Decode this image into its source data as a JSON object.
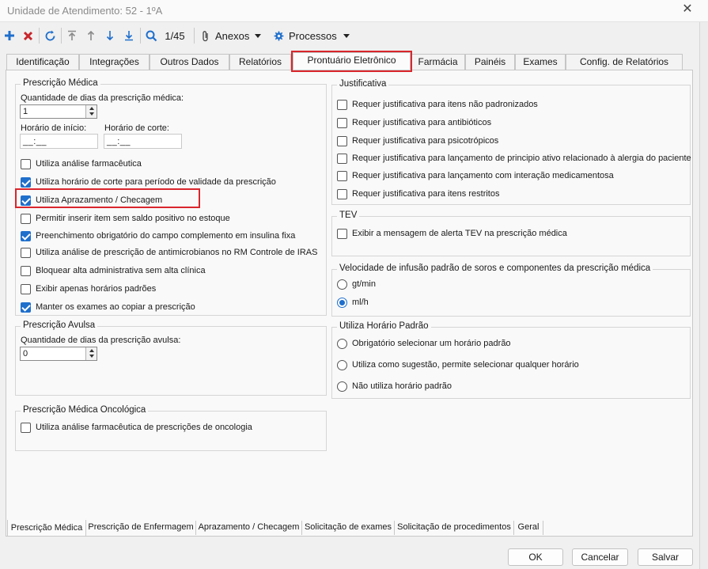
{
  "window": {
    "title": "Unidade de Atendimento: 52 - 1ºA",
    "close_icon": "close-icon"
  },
  "toolbar": {
    "record_position": "1/45",
    "anexos_label": "Anexos",
    "processos_label": "Processos",
    "colors": {
      "add": "#1f6fcc",
      "delete": "#c8262c",
      "nav": "#1f6fcc"
    }
  },
  "tabs": [
    {
      "label": "Identificação"
    },
    {
      "label": "Integrações"
    },
    {
      "label": "Outros Dados"
    },
    {
      "label": "Relatórios"
    },
    {
      "label": "Prontuário Eletrônico",
      "active": true
    },
    {
      "label": "Farmácia"
    },
    {
      "label": "Painéis"
    },
    {
      "label": "Exames"
    },
    {
      "label": "Config. de Relatórios"
    }
  ],
  "prescricao_medica": {
    "title": "Prescrição Médica",
    "dias_label": "Quantidade de dias da prescrição médica:",
    "dias_value": "1",
    "inicio_label": "Horário de início:",
    "inicio_value": "__:__",
    "corte_label": "Horário de corte:",
    "corte_value": "__:__",
    "options": [
      {
        "label": "Utiliza análise farmacêutica",
        "checked": false
      },
      {
        "label": "Utiliza horário de corte para período de validade da prescrição",
        "checked": true
      },
      {
        "label": "Utiliza Aprazamento / Checagem",
        "checked": true
      },
      {
        "label": "Permitir inserir item sem saldo positivo no estoque",
        "checked": false
      },
      {
        "label": "Preenchimento obrigatório do campo complemento em insulina fixa",
        "checked": true
      },
      {
        "label": "Utiliza análise de prescrição de antimicrobianos no RM Controle de IRAS",
        "checked": false
      },
      {
        "label": "Bloquear alta administrativa sem alta clínica",
        "checked": false
      },
      {
        "label": "Exibir apenas horários padrões",
        "checked": false
      },
      {
        "label": "Manter os exames ao copiar a prescrição",
        "checked": true
      }
    ]
  },
  "prescricao_avulsa": {
    "title": "Prescrição Avulsa",
    "dias_label": "Quantidade de dias da prescrição avulsa:",
    "dias_value": "0"
  },
  "prescricao_oncologica": {
    "title": "Prescrição Médica Oncológica",
    "option": {
      "label": "Utiliza análise farmacêutica de prescrições de oncologia",
      "checked": false
    }
  },
  "justificativa": {
    "title": "Justificativa",
    "options": [
      {
        "label": "Requer justificativa para itens não padronizados",
        "checked": false
      },
      {
        "label": "Requer justificativa para antibióticos",
        "checked": false
      },
      {
        "label": "Requer justificativa para psicotrópicos",
        "checked": false
      },
      {
        "label": "Requer justificativa para lançamento de principio ativo relacionado à alergia do paciente",
        "checked": false
      },
      {
        "label": "Requer justificativa para lançamento com interação medicamentosa",
        "checked": false
      },
      {
        "label": "Requer justificativa para itens restritos",
        "checked": false
      }
    ]
  },
  "tev": {
    "title": "TEV",
    "option": {
      "label": "Exibir a mensagem de alerta TEV na prescrição médica",
      "checked": false
    }
  },
  "velocidade": {
    "title": "Velocidade de infusão padrão de soros e componentes da prescrição médica",
    "options": [
      {
        "label": "gt/min",
        "checked": false
      },
      {
        "label": "ml/h",
        "checked": true
      }
    ]
  },
  "horario_padrao": {
    "title": "Utiliza Horário Padrão",
    "options": [
      {
        "label": "Obrigatório selecionar um horário padrão",
        "checked": false
      },
      {
        "label": "Utiliza como sugestão, permite selecionar qualquer horário",
        "checked": false
      },
      {
        "label": "Não utiliza horário padrão",
        "checked": false
      }
    ]
  },
  "bottom_tabs": [
    {
      "label": "Prescrição Médica",
      "active": true
    },
    {
      "label": "Prescrição de Enfermagem"
    },
    {
      "label": "Aprazamento / Checagem"
    },
    {
      "label": "Solicitação de exames"
    },
    {
      "label": "Solicitação de procedimentos"
    },
    {
      "label": "Geral"
    }
  ],
  "buttons": {
    "ok": "OK",
    "cancel": "Cancelar",
    "save": "Salvar"
  },
  "highlight_color": "#d9262c"
}
